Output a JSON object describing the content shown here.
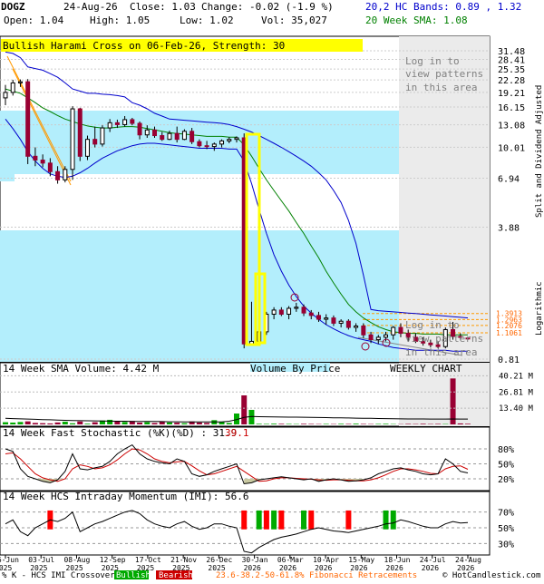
{
  "header": {
    "symbol": "DOGZ",
    "date": "24-Aug-26",
    "close": "Close: 1.03",
    "change": "Change: -0.02 (-1.9 %)",
    "open": "Open: 1.04",
    "high": "High: 1.05",
    "low": "Low: 1.02",
    "vol": "Vol: 35,027",
    "bands": "20,2 HC Bands: 0.89 , 1.32",
    "sma": "20 Week SMA: 1.08"
  },
  "pattern_banner": "Bullish Harami Cross on 06-Feb-26, Strength: 30",
  "login_top": [
    "Log in to",
    "view patterns",
    "in this area"
  ],
  "login_bottom": [
    "Log in to",
    "view patterns",
    "in this area"
  ],
  "right_axis_title": "Split and Dividend Adjusted",
  "log_label": "Logarithmic",
  "price_ticks": [
    "31.48",
    "28.41",
    "25.35",
    "22.28",
    "19.21",
    "16.15",
    "13.08",
    "10.01",
    "6.94",
    "3.88",
    "0.81"
  ],
  "fib_levels": [
    "1.3913",
    "1.2963",
    "1.2076",
    "1.1061"
  ],
  "volume_label": "14 Week SMA Volume: 4.42 M",
  "vbp_label": "Volume By Price",
  "weekly_label": "WEEKLY CHART",
  "volume_ticks": [
    "40.21 M",
    "26.81 M",
    "13.40 M"
  ],
  "stoch_label": "14 Week Fast Stochastic (%K)(%D) : 31.9",
  "stoch_d_value": "39.1",
  "stoch_ticks": [
    "80%",
    "50%",
    "20%"
  ],
  "imi_label": "14 Week HCS Intraday Momentum (IMI): 56.6",
  "imi_ticks": [
    "70%",
    "50%",
    "30%"
  ],
  "x_ticks": [
    [
      "06-Jun",
      "2025"
    ],
    [
      "03-Jul",
      "2025"
    ],
    [
      "08-Aug",
      "2025"
    ],
    [
      "12-Sep",
      "2025"
    ],
    [
      "17-Oct",
      "2025"
    ],
    [
      "21-Nov",
      "2025"
    ],
    [
      "26-Dec",
      "2025"
    ],
    [
      "30-Jan",
      "2026"
    ],
    [
      "06-Mar",
      "2026"
    ],
    [
      "10-Apr",
      "2026"
    ],
    [
      "15-May",
      "2026"
    ],
    [
      "18-Jun",
      "2026"
    ],
    [
      "24-Jul",
      "2026"
    ],
    [
      "24-Aug",
      "2026"
    ]
  ],
  "footer": {
    "legend_prefix": "% K - HCS IMI Crossover:",
    "bullish": "Bullish",
    "bearish": "Bearish",
    "fib": "23.6-38.2-50-61.8% Fibonacci Retracements",
    "copyright": "© HotCandlestick.com"
  },
  "colors": {
    "bull": "#00aa00",
    "bear": "#990033",
    "band": "#0000cc",
    "sma": "#008000",
    "cyan": "#b3eefc",
    "fib": "#ff9900"
  },
  "chart_data": {
    "type": "candlestick",
    "scale": "log",
    "ylim": [
      0.81,
      31.48
    ],
    "candles": [
      {
        "o": 18.0,
        "h": 21.0,
        "l": 16.5,
        "c": 19.2
      },
      {
        "o": 19.2,
        "h": 22.3,
        "l": 18.5,
        "c": 21.5
      },
      {
        "o": 21.5,
        "h": 22.4,
        "l": 20.5,
        "c": 21.8
      },
      {
        "o": 21.8,
        "h": 22.5,
        "l": 8.2,
        "c": 9.0
      },
      {
        "o": 9.0,
        "h": 10.0,
        "l": 8.0,
        "c": 8.6
      },
      {
        "o": 8.6,
        "h": 9.2,
        "l": 7.9,
        "c": 8.3
      },
      {
        "o": 8.3,
        "h": 8.8,
        "l": 7.1,
        "c": 7.5
      },
      {
        "o": 7.5,
        "h": 8.0,
        "l": 6.5,
        "c": 6.8
      },
      {
        "o": 6.8,
        "h": 8.0,
        "l": 6.6,
        "c": 7.7
      },
      {
        "o": 7.7,
        "h": 16.3,
        "l": 6.8,
        "c": 15.8
      },
      {
        "o": 15.8,
        "h": 16.0,
        "l": 8.5,
        "c": 9.0
      },
      {
        "o": 9.0,
        "h": 11.5,
        "l": 8.6,
        "c": 11.0
      },
      {
        "o": 11.0,
        "h": 12.8,
        "l": 10.0,
        "c": 10.4
      },
      {
        "o": 10.4,
        "h": 13.0,
        "l": 10.1,
        "c": 12.6
      },
      {
        "o": 12.6,
        "h": 14.0,
        "l": 12.0,
        "c": 13.4
      },
      {
        "o": 13.4,
        "h": 13.9,
        "l": 12.6,
        "c": 13.1
      },
      {
        "o": 13.1,
        "h": 14.5,
        "l": 12.8,
        "c": 13.9
      },
      {
        "o": 13.9,
        "h": 14.2,
        "l": 13.0,
        "c": 13.3
      },
      {
        "o": 13.3,
        "h": 13.6,
        "l": 11.0,
        "c": 11.6
      },
      {
        "o": 11.6,
        "h": 13.0,
        "l": 11.2,
        "c": 12.3
      },
      {
        "o": 12.3,
        "h": 12.8,
        "l": 11.2,
        "c": 11.5
      },
      {
        "o": 11.5,
        "h": 12.0,
        "l": 10.8,
        "c": 11.0
      },
      {
        "o": 11.0,
        "h": 12.2,
        "l": 10.9,
        "c": 11.8
      },
      {
        "o": 11.8,
        "h": 12.8,
        "l": 10.6,
        "c": 11.0
      },
      {
        "o": 11.0,
        "h": 12.4,
        "l": 10.9,
        "c": 12.1
      },
      {
        "o": 12.1,
        "h": 12.6,
        "l": 10.4,
        "c": 10.7
      },
      {
        "o": 10.7,
        "h": 11.0,
        "l": 10.0,
        "c": 10.2
      },
      {
        "o": 10.2,
        "h": 10.8,
        "l": 9.8,
        "c": 10.1
      },
      {
        "o": 10.1,
        "h": 10.6,
        "l": 9.6,
        "c": 10.4
      },
      {
        "o": 10.4,
        "h": 11.0,
        "l": 10.0,
        "c": 10.8
      },
      {
        "o": 10.8,
        "h": 11.3,
        "l": 10.5,
        "c": 11.0
      },
      {
        "o": 11.0,
        "h": 11.4,
        "l": 10.6,
        "c": 11.2
      },
      {
        "o": 11.2,
        "h": 11.8,
        "l": 0.92,
        "c": 0.97
      },
      {
        "o": 0.97,
        "h": 1.6,
        "l": 0.95,
        "c": 1.0
      },
      {
        "o": 1.0,
        "h": 1.3,
        "l": 1.0,
        "c": 1.12
      },
      {
        "o": 1.12,
        "h": 1.42,
        "l": 1.08,
        "c": 1.38
      },
      {
        "o": 1.38,
        "h": 1.5,
        "l": 1.3,
        "c": 1.45
      },
      {
        "o": 1.45,
        "h": 1.5,
        "l": 1.35,
        "c": 1.38
      },
      {
        "o": 1.38,
        "h": 1.52,
        "l": 1.3,
        "c": 1.48
      },
      {
        "o": 1.48,
        "h": 1.58,
        "l": 1.42,
        "c": 1.5
      },
      {
        "o": 1.5,
        "h": 1.55,
        "l": 1.35,
        "c": 1.4
      },
      {
        "o": 1.4,
        "h": 1.45,
        "l": 1.3,
        "c": 1.36
      },
      {
        "o": 1.36,
        "h": 1.42,
        "l": 1.26,
        "c": 1.3
      },
      {
        "o": 1.3,
        "h": 1.38,
        "l": 1.22,
        "c": 1.32
      },
      {
        "o": 1.32,
        "h": 1.36,
        "l": 1.2,
        "c": 1.24
      },
      {
        "o": 1.24,
        "h": 1.3,
        "l": 1.18,
        "c": 1.27
      },
      {
        "o": 1.27,
        "h": 1.3,
        "l": 1.15,
        "c": 1.18
      },
      {
        "o": 1.18,
        "h": 1.24,
        "l": 1.12,
        "c": 1.2
      },
      {
        "o": 1.2,
        "h": 1.24,
        "l": 1.04,
        "c": 1.08
      },
      {
        "o": 1.08,
        "h": 1.12,
        "l": 0.98,
        "c": 1.02
      },
      {
        "o": 1.02,
        "h": 1.08,
        "l": 0.97,
        "c": 1.05
      },
      {
        "o": 1.05,
        "h": 1.12,
        "l": 1.0,
        "c": 1.08
      },
      {
        "o": 1.08,
        "h": 1.2,
        "l": 1.02,
        "c": 1.18
      },
      {
        "o": 1.18,
        "h": 1.24,
        "l": 1.05,
        "c": 1.1
      },
      {
        "o": 1.1,
        "h": 1.15,
        "l": 1.0,
        "c": 1.05
      },
      {
        "o": 1.05,
        "h": 1.1,
        "l": 0.98,
        "c": 1.0
      },
      {
        "o": 1.0,
        "h": 1.05,
        "l": 0.95,
        "c": 0.98
      },
      {
        "o": 0.98,
        "h": 1.02,
        "l": 0.93,
        "c": 0.96
      },
      {
        "o": 0.96,
        "h": 1.0,
        "l": 0.92,
        "c": 0.94
      },
      {
        "o": 0.94,
        "h": 1.18,
        "l": 0.92,
        "c": 1.15
      },
      {
        "o": 1.15,
        "h": 1.26,
        "l": 1.02,
        "c": 1.06
      },
      {
        "o": 1.06,
        "h": 1.1,
        "l": 1.02,
        "c": 1.05
      },
      {
        "o": 1.04,
        "h": 1.05,
        "l": 1.02,
        "c": 1.03
      }
    ],
    "upper_band": [
      31.0,
      30.5,
      29.0,
      26.0,
      25.5,
      25.0,
      24.0,
      23.0,
      21.5,
      20.0,
      19.5,
      19.0,
      19.0,
      18.8,
      18.7,
      18.5,
      18.2,
      17.0,
      16.5,
      15.8,
      15.0,
      14.5,
      14.0,
      13.9,
      13.8,
      13.7,
      13.6,
      13.5,
      13.4,
      13.3,
      13.1,
      12.8,
      12.4,
      12.0,
      11.5,
      11.0,
      10.5,
      10.0,
      9.5,
      9.0,
      8.5,
      8.0,
      7.4,
      6.8,
      6.0,
      5.2,
      4.2,
      3.2,
      2.2,
      1.46,
      1.44,
      1.43,
      1.42,
      1.41,
      1.4,
      1.39,
      1.38,
      1.37,
      1.36,
      1.35,
      1.34,
      1.33,
      1.32
    ],
    "lower_band": [
      14.0,
      12.5,
      11.0,
      9.5,
      8.5,
      7.8,
      7.3,
      7.1,
      7.0,
      7.1,
      7.4,
      7.8,
      8.3,
      8.8,
      9.2,
      9.6,
      9.9,
      10.2,
      10.4,
      10.5,
      10.5,
      10.4,
      10.3,
      10.2,
      10.1,
      10.0,
      9.9,
      9.9,
      9.9,
      9.9,
      9.8,
      9.8,
      8.5,
      6.5,
      4.8,
      3.6,
      2.8,
      2.3,
      1.95,
      1.7,
      1.52,
      1.4,
      1.3,
      1.22,
      1.16,
      1.11,
      1.07,
      1.04,
      1.02,
      1.0,
      0.97,
      0.95,
      0.93,
      0.92,
      0.91,
      0.9,
      0.9,
      0.9,
      0.9,
      0.9,
      0.89,
      0.89,
      0.89
    ],
    "sma": [
      20.0,
      19.5,
      19.0,
      18.0,
      17.0,
      16.0,
      15.3,
      14.6,
      14.0,
      13.6,
      13.2,
      12.9,
      12.7,
      12.6,
      12.6,
      12.7,
      12.8,
      12.8,
      12.7,
      12.5,
      12.3,
      12.1,
      11.9,
      11.8,
      11.7,
      11.6,
      11.5,
      11.4,
      11.4,
      11.4,
      11.3,
      11.3,
      10.3,
      9.0,
      7.8,
      6.8,
      6.0,
      5.3,
      4.7,
      4.1,
      3.6,
      3.1,
      2.7,
      2.3,
      2.0,
      1.75,
      1.55,
      1.42,
      1.32,
      1.25,
      1.19,
      1.15,
      1.12,
      1.11,
      1.1,
      1.1,
      1.09,
      1.09,
      1.09,
      1.08,
      1.08,
      1.08,
      1.08
    ],
    "volume_m": [
      1.8,
      1.5,
      2.0,
      2.5,
      1.2,
      1.0,
      0.8,
      1.6,
      2.2,
      0.9,
      2.4,
      0.6,
      1.8,
      3.2,
      3.8,
      2.5,
      2.0,
      2.8,
      1.5,
      1.9,
      1.2,
      2.2,
      1.6,
      1.4,
      1.0,
      2.4,
      1.5,
      1.2,
      3.5,
      2.0,
      1.2,
      9.0,
      24.0,
      12.0,
      0.5,
      0.4,
      0.6,
      0.5,
      0.4,
      0.3,
      0.5,
      0.4,
      0.3,
      0.4,
      0.3,
      0.5,
      0.4,
      0.6,
      0.4,
      0.3,
      0.4,
      0.5,
      0.3,
      0.2,
      0.4,
      0.3,
      0.5,
      0.3,
      0.4,
      0.3,
      38.0,
      0.8,
      0.5
    ],
    "volume_sma_m": [
      5.0,
      4.8,
      4.6,
      4.4,
      4.2,
      4.0,
      3.8,
      3.6,
      3.4,
      3.2,
      3.1,
      3.0,
      2.9,
      2.8,
      2.7,
      2.6,
      2.6,
      2.5,
      2.5,
      2.4,
      2.4,
      2.3,
      2.2,
      2.2,
      2.1,
      2.1,
      2.0,
      2.0,
      2.0,
      2.1,
      2.6,
      4.0,
      5.8,
      6.5,
      6.4,
      6.3,
      6.2,
      6.1,
      6.0,
      6.0,
      5.9,
      5.8,
      5.7,
      5.6,
      5.5,
      5.4,
      5.3,
      5.2,
      5.1,
      5.0,
      4.9,
      4.8,
      4.7,
      4.6,
      4.5,
      4.5,
      4.5,
      4.4,
      4.4,
      4.4,
      4.5,
      4.45,
      4.42
    ],
    "stoch_k": [
      80,
      75,
      40,
      25,
      20,
      15,
      12,
      18,
      35,
      70,
      40,
      38,
      42,
      45,
      55,
      70,
      80,
      88,
      70,
      60,
      55,
      52,
      50,
      60,
      55,
      30,
      25,
      28,
      35,
      40,
      45,
      50,
      10,
      12,
      18,
      20,
      22,
      24,
      22,
      20,
      18,
      20,
      15,
      18,
      20,
      18,
      15,
      16,
      18,
      22,
      30,
      35,
      40,
      42,
      38,
      35,
      30,
      28,
      30,
      60,
      50,
      35,
      31.9
    ],
    "stoch_d": [
      70,
      72,
      60,
      45,
      30,
      22,
      18,
      15,
      20,
      40,
      48,
      45,
      40,
      42,
      48,
      58,
      70,
      80,
      78,
      70,
      60,
      55,
      52,
      54,
      55,
      46,
      36,
      28,
      30,
      35,
      40,
      45,
      35,
      25,
      15,
      16,
      20,
      22,
      22,
      21,
      20,
      19,
      18,
      17,
      18,
      18,
      17,
      16,
      16,
      18,
      22,
      28,
      35,
      40,
      40,
      38,
      35,
      31,
      30,
      40,
      45,
      46,
      39.1
    ],
    "imi": [
      55,
      60,
      45,
      40,
      50,
      55,
      60,
      58,
      62,
      70,
      45,
      50,
      55,
      58,
      62,
      66,
      70,
      72,
      68,
      60,
      55,
      52,
      50,
      55,
      58,
      52,
      48,
      50,
      55,
      55,
      52,
      50,
      20,
      18,
      25,
      30,
      35,
      38,
      40,
      42,
      45,
      48,
      50,
      48,
      46,
      45,
      44,
      46,
      48,
      50,
      52,
      55,
      56,
      60,
      58,
      55,
      52,
      50,
      50,
      55,
      58,
      56,
      56.6
    ],
    "crossovers": [
      {
        "i": 6,
        "type": "bear"
      },
      {
        "i": 32,
        "type": "bear"
      },
      {
        "i": 34,
        "type": "bull"
      },
      {
        "i": 35,
        "type": "bear"
      },
      {
        "i": 36,
        "type": "bull"
      },
      {
        "i": 37,
        "type": "bear"
      },
      {
        "i": 40,
        "type": "bull"
      },
      {
        "i": 41,
        "type": "bear"
      },
      {
        "i": 46,
        "type": "bear"
      },
      {
        "i": 51,
        "type": "bull"
      },
      {
        "i": 52,
        "type": "bull"
      }
    ]
  }
}
